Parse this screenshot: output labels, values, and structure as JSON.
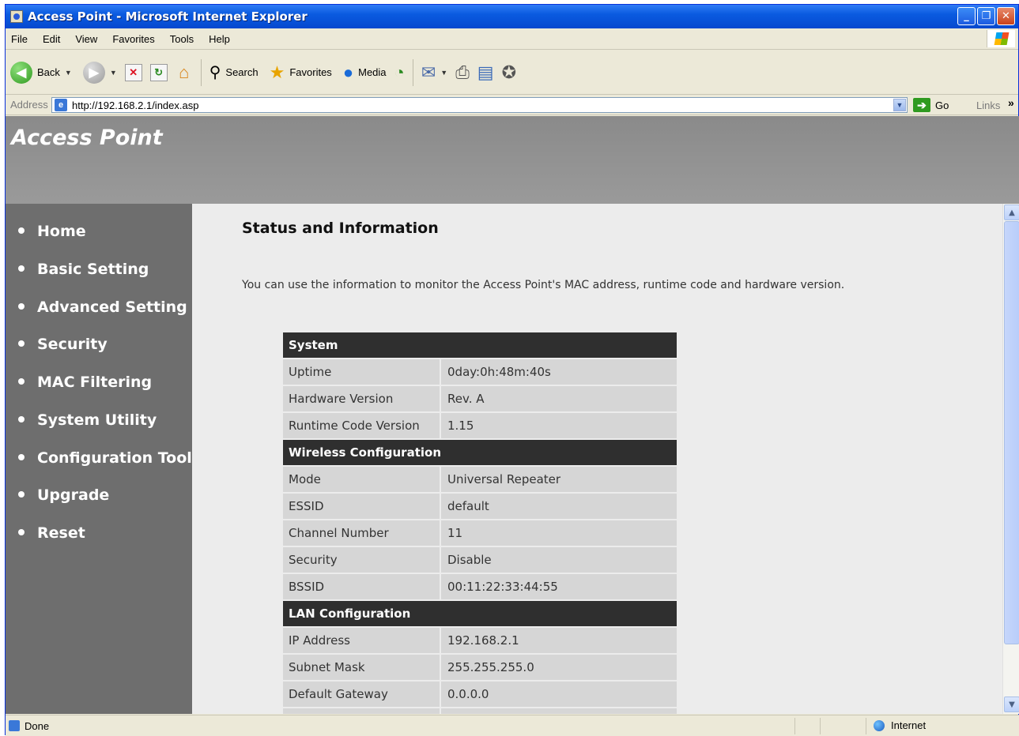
{
  "window": {
    "title": "Access Point - Microsoft Internet Explorer",
    "controls": {
      "minimize": "_",
      "restore": "❐",
      "close": "✕"
    }
  },
  "menu": [
    "File",
    "Edit",
    "View",
    "Favorites",
    "Tools",
    "Help"
  ],
  "toolbar": {
    "back": "Back",
    "search": "Search",
    "favorites": "Favorites",
    "media": "Media"
  },
  "address": {
    "label": "Address",
    "url": "http://192.168.2.1/index.asp",
    "go": "Go",
    "links": "Links"
  },
  "banner": {
    "title": "Access Point"
  },
  "sidebar": {
    "items": [
      {
        "label": "Home"
      },
      {
        "label": "Basic Setting"
      },
      {
        "label": "Advanced Setting"
      },
      {
        "label": "Security"
      },
      {
        "label": "MAC Filtering"
      },
      {
        "label": "System Utility"
      },
      {
        "label": "Configuration Tool"
      },
      {
        "label": "Upgrade"
      },
      {
        "label": "Reset"
      }
    ]
  },
  "main": {
    "title": "Status and Information",
    "description": "You can use the information to monitor the Access Point's MAC address, runtime code and hardware version."
  },
  "status_table": {
    "sections": [
      {
        "heading": "System",
        "rows": [
          {
            "label": "Uptime",
            "value": "0day:0h:48m:40s"
          },
          {
            "label": "Hardware Version",
            "value": "Rev. A"
          },
          {
            "label": "Runtime Code Version",
            "value": "1.15"
          }
        ]
      },
      {
        "heading": "Wireless Configuration",
        "rows": [
          {
            "label": "Mode",
            "value": "Universal Repeater"
          },
          {
            "label": "ESSID",
            "value": "default"
          },
          {
            "label": "Channel Number",
            "value": "11"
          },
          {
            "label": "Security",
            "value": "Disable"
          },
          {
            "label": "BSSID",
            "value": "00:11:22:33:44:55"
          }
        ]
      },
      {
        "heading": "LAN Configuration",
        "rows": [
          {
            "label": "IP Address",
            "value": "192.168.2.1"
          },
          {
            "label": "Subnet Mask",
            "value": "255.255.255.0"
          },
          {
            "label": "Default Gateway",
            "value": "0.0.0.0"
          }
        ]
      }
    ]
  },
  "statusbar": {
    "status": "Done",
    "zone": "Internet"
  }
}
